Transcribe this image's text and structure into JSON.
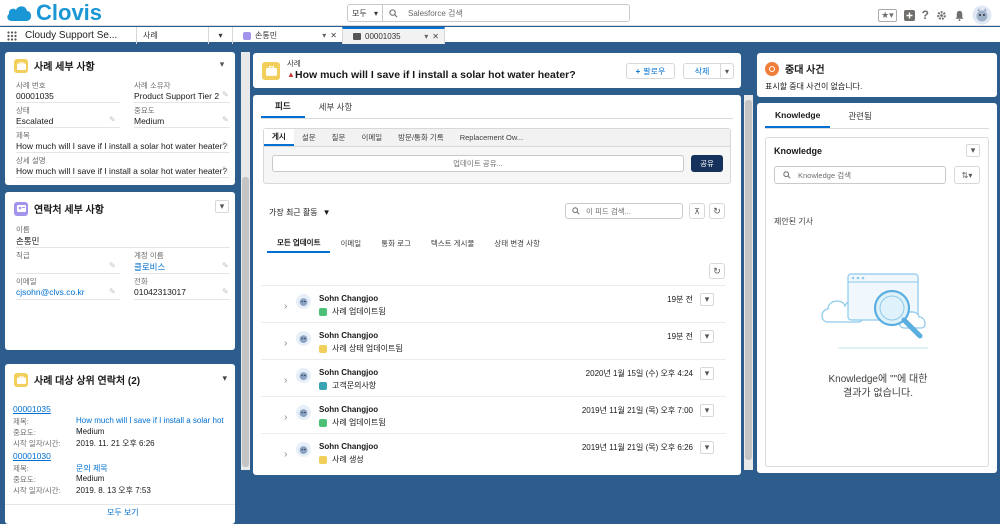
{
  "header": {
    "brand": "Clovis",
    "search_scope": "모두",
    "search_placeholder": "Salesforce 검색"
  },
  "nav": {
    "app_name": "Cloudy Support Se...",
    "tabs": [
      {
        "label": "사례"
      },
      {
        "label": "손통민"
      },
      {
        "label": "00001035"
      }
    ]
  },
  "case_details": {
    "title": "사례 세부 사항",
    "fields": {
      "case_number_label": "사례 번호",
      "case_number": "00001035",
      "owner_label": "사례 소유자",
      "owner": "Product Support Tier 2",
      "status_label": "상태",
      "status": "Escalated",
      "priority_label": "중요도",
      "priority": "Medium",
      "subject_label": "제목",
      "subject": "How much will I save if I install a solar hot water heater?",
      "description_label": "상세 설명",
      "description": "How much will I save if I install a solar hot water heater?"
    }
  },
  "contact_details": {
    "title": "연락처 세부 사항",
    "fields": {
      "name_label": "이름",
      "name": "손통민",
      "title_label": "직급",
      "title": "",
      "account_label": "계정 이름",
      "account": "클로비스",
      "email_label": "이메일",
      "email": "cjsohn@clvs.co.kr",
      "phone_label": "전화",
      "phone": "01042313017"
    }
  },
  "related_cases": {
    "title": "사례 대상 상위 연락처 (2)",
    "items": [
      {
        "number": "00001035",
        "subject_label": "제목:",
        "subject": "How much will I save if I install a solar hot ...",
        "priority_label": "중요도:",
        "priority": "Medium",
        "date_label": "시작 일자/시간:",
        "date": "2019. 11. 21 오후 6:26"
      },
      {
        "number": "00001030",
        "subject_label": "제목:",
        "subject": "문의 제목",
        "priority_label": "중요도:",
        "priority": "Medium",
        "date_label": "시작 일자/시간:",
        "date": "2019. 8. 13 오후 7:53"
      }
    ],
    "view_all": "모두 보기"
  },
  "case_header": {
    "object_label": "사례",
    "title": "How much will I save if I install a solar hot water heater?",
    "follow_label": "팔로우",
    "delete_label": "삭제"
  },
  "main_tabs": {
    "feed": "피드",
    "details": "세부 사항"
  },
  "publisher": {
    "tabs": [
      "게시",
      "설문",
      "질문",
      "이메일",
      "방문/통화 기록",
      "Replacement Ow..."
    ],
    "placeholder": "업데이트 공유...",
    "share_label": "공유"
  },
  "feed": {
    "sort_label": "가장 최근 활동",
    "search_placeholder": "이 피드 검색...",
    "filters": [
      "모든 업데이트",
      "이메일",
      "통화 로그",
      "텍스트 게시물",
      "상태 변경 사항"
    ],
    "items": [
      {
        "name": "Sohn Changjoo",
        "action": "사례 업데이트됨",
        "time": "19분 전",
        "color": "#4bc076"
      },
      {
        "name": "Sohn Changjoo",
        "action": "사례 상태 업데이트됨",
        "time": "19분 전",
        "color": "#f2cf5b"
      },
      {
        "name": "Sohn Changjoo",
        "action": "고객문의사항",
        "time": "2020년 1월 15일 (수) 오후 4:24",
        "color": "#3ba4b4"
      },
      {
        "name": "Sohn Changjoo",
        "action": "사례 업데이트됨",
        "time": "2019년 11월 21일 (목) 오후 7:00",
        "color": "#4bc076"
      },
      {
        "name": "Sohn Changjoo",
        "action": "사례 생성",
        "time": "2019년 11월 21일 (목) 오후 6:26",
        "color": "#f2cf5b"
      }
    ]
  },
  "major_event": {
    "title": "중대 사건",
    "body": "표시할 중대 사건이 없습니다."
  },
  "knowledge": {
    "tabs": [
      "Knowledge",
      "관련됨"
    ],
    "title": "Knowledge",
    "search_placeholder": "Knowledge 검색",
    "suggested_label": "제안된 기사",
    "empty_line1": "Knowledge에 \"\"에 대한",
    "empty_line2": "결과가 없습니다."
  },
  "colors": {
    "brand": "#1b96d4",
    "accent": "#0070d2",
    "navy": "#2c5d8c"
  }
}
